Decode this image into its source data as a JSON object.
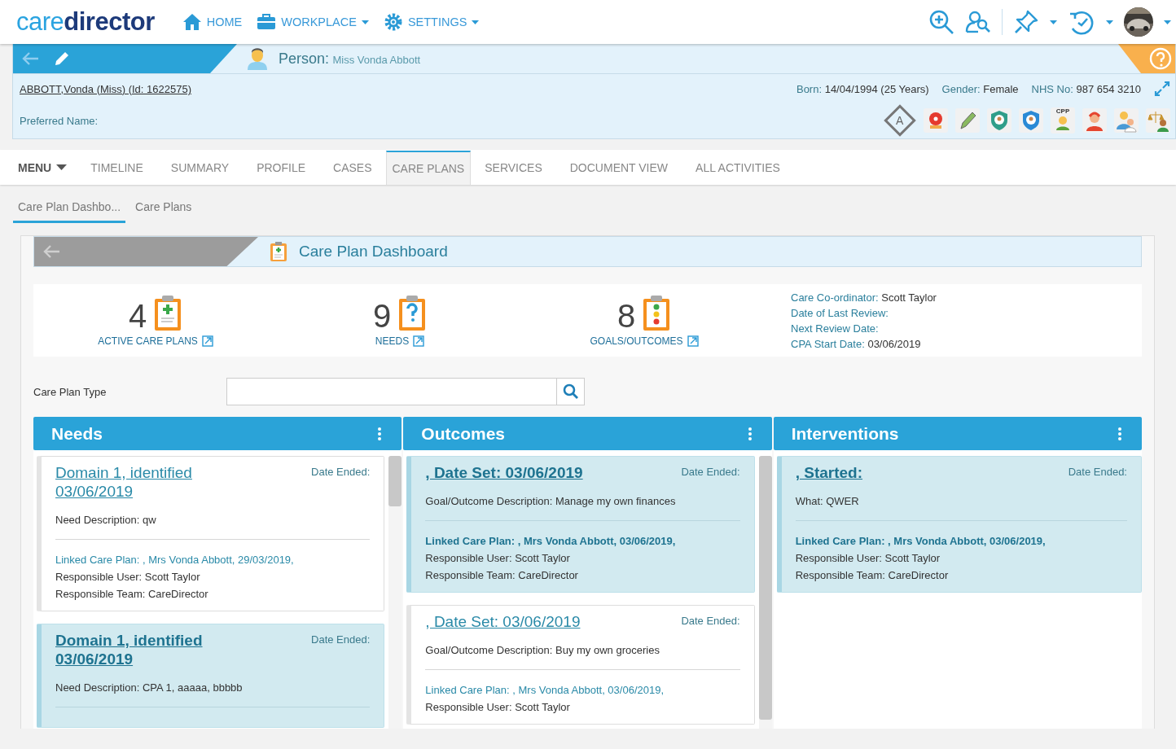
{
  "logo": {
    "light": "care",
    "bold": "director"
  },
  "nav": [
    {
      "label": "HOME",
      "kind": "home",
      "dropdown": false
    },
    {
      "label": "WORKPLACE",
      "kind": "briefcase",
      "dropdown": true
    },
    {
      "label": "SETTINGS",
      "kind": "gear",
      "dropdown": true
    }
  ],
  "person": {
    "label": "Person:",
    "name": "Miss Vonda Abbott",
    "record_link": "ABBOTT,Vonda (Miss) (Id: 1622575)",
    "preferred_label": "Preferred Name:",
    "facts": [
      {
        "label": "Born:",
        "value": "14/04/1994 (25 Years)"
      },
      {
        "label": "Gender:",
        "value": "Female"
      },
      {
        "label": "NHS No:",
        "value": "987 654 3210"
      }
    ]
  },
  "badges": [
    {
      "kind": "letter",
      "text": "A"
    },
    {
      "kind": "alarm"
    },
    {
      "kind": "pencil"
    },
    {
      "kind": "shield_green"
    },
    {
      "kind": "shield_blue"
    },
    {
      "kind": "cpp",
      "text": "CPP"
    },
    {
      "kind": "headset"
    },
    {
      "kind": "doctor"
    },
    {
      "kind": "scales"
    }
  ],
  "menu": "MENU",
  "tabs": [
    {
      "label": "TIMELINE",
      "selected": false
    },
    {
      "label": "SUMMARY",
      "selected": false
    },
    {
      "label": "PROFILE",
      "selected": false
    },
    {
      "label": "CASES",
      "selected": false
    },
    {
      "label": "CARE PLANS",
      "selected": true
    },
    {
      "label": "SERVICES",
      "selected": false
    },
    {
      "label": "DOCUMENT VIEW",
      "selected": false
    },
    {
      "label": "ALL ACTIVITIES",
      "selected": false
    }
  ],
  "subtabs": [
    {
      "label": "Care Plan Dashbo...",
      "selected": true
    },
    {
      "label": "Care Plans",
      "selected": false
    }
  ],
  "dashboard": {
    "title": "Care Plan Dashboard",
    "stats": [
      {
        "count": "4",
        "label": "ACTIVE CARE PLANS",
        "kind": "plus"
      },
      {
        "count": "9",
        "label": "NEEDS",
        "kind": "question"
      },
      {
        "count": "8",
        "label": "GOALS/OUTCOMES",
        "kind": "traffic"
      }
    ],
    "details": [
      {
        "label": "Care Co-ordinator:",
        "value": "Scott Taylor"
      },
      {
        "label": "Date of Last Review:"
      },
      {
        "label": "Next Review Date:"
      },
      {
        "label": "CPA Start Date:",
        "value": "03/06/2019"
      }
    ]
  },
  "filter": {
    "label": "Care Plan Type"
  },
  "columns": [
    {
      "title": "Needs",
      "cards": [
        {
          "selected": false,
          "title": "Domain 1, identified 03/06/2019",
          "date_label": "Date Ended:",
          "description": "Need Description: qw",
          "linked": "Linked Care Plan: , Mrs Vonda Abbott, 29/03/2019,",
          "user": "Responsible User: Scott Taylor",
          "team": "Responsible Team: CareDirector"
        },
        {
          "selected": true,
          "title": "Domain 1, identified 03/06/2019",
          "date_label": "Date Ended:",
          "description": "Need Description: CPA 1, aaaaa, bbbbb"
        }
      ]
    },
    {
      "title": "Outcomes",
      "cards": [
        {
          "selected": true,
          "title": ", Date Set: 03/06/2019",
          "date_label": "Date Ended:",
          "description": "Goal/Outcome Description: Manage my own finances",
          "linked": "Linked Care Plan: , Mrs Vonda Abbott, 03/06/2019,",
          "user": "Responsible User: Scott Taylor",
          "team": "Responsible Team: CareDirector"
        },
        {
          "selected": false,
          "title": ", Date Set: 03/06/2019",
          "date_label": "Date Ended:",
          "description": "Goal/Outcome Description: Buy my own groceries",
          "linked": "Linked Care Plan: , Mrs Vonda Abbott, 03/06/2019,",
          "user": "Responsible User: Scott Taylor"
        }
      ]
    },
    {
      "title": "Interventions",
      "cards": [
        {
          "selected": true,
          "title": ", Started:",
          "date_label": "Date Ended:",
          "description": "What: QWER",
          "linked": "Linked Care Plan: , Mrs Vonda Abbott, 03/06/2019,",
          "user": "Responsible User: Scott Taylor",
          "team": "Responsible Team: CareDirector"
        }
      ]
    }
  ]
}
